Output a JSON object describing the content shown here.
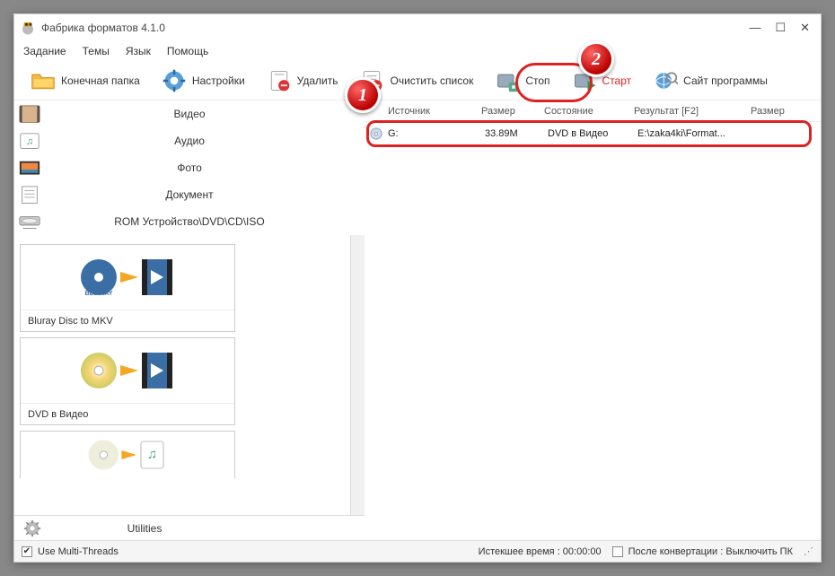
{
  "window": {
    "title": "Фабрика форматов 4.1.0"
  },
  "menu": {
    "task": "Задание",
    "themes": "Темы",
    "lang": "Язык",
    "help": "Помощь"
  },
  "toolbar": {
    "output": "Конечная папка",
    "settings": "Настройки",
    "delete": "Удалить",
    "clear": "Очистить список",
    "stop": "Стоп",
    "start": "Старт",
    "site": "Сайт программы"
  },
  "categories": {
    "video": "Видео",
    "audio": "Аудио",
    "photo": "Фото",
    "document": "Документ",
    "rom": "ROM Устройство\\DVD\\CD\\ISO"
  },
  "presets": {
    "bluray": "Bluray Disc to MKV",
    "dvdvideo": "DVD в Видео",
    "third": ""
  },
  "utilities": "Utilities",
  "columns": {
    "source": "Источник",
    "size": "Размер",
    "state": "Состояние",
    "result": "Результат [F2]",
    "rsize": "Размер"
  },
  "row": {
    "source": "G:",
    "size": "33.89M",
    "state": "DVD в Видео",
    "result": "E:\\zaka4ki\\Format..."
  },
  "status": {
    "multithread": "Use Multi-Threads",
    "elapsed": "Истекшее время : 00:00:00",
    "after": "После конвертации : Выключить ПК"
  },
  "badges": {
    "one": "1",
    "two": "2"
  }
}
